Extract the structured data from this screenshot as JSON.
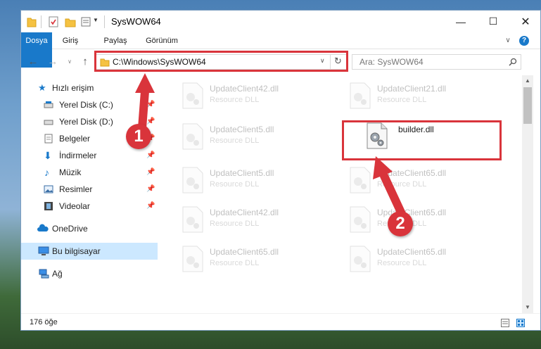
{
  "window": {
    "title": "SysWOW64"
  },
  "ribbon": {
    "tabs": [
      "Dosya",
      "Giriş",
      "Paylaş",
      "Görünüm"
    ]
  },
  "address": {
    "path": "C:\\Windows\\SysWOW64"
  },
  "search": {
    "placeholder": "Ara: SysWOW64"
  },
  "nav": {
    "quick_access": "Hızlı erişim",
    "items": [
      "Yerel Disk (C:)",
      "Yerel Disk (D:)",
      "Belgeler",
      "İndirmeler",
      "Müzik",
      "Resimler",
      "Videolar"
    ],
    "onedrive": "OneDrive",
    "this_pc": "Bu bilgisayar",
    "network": "Ağ"
  },
  "files": [
    {
      "name": "UpdateClient42.dll",
      "desc": "Resource DLL"
    },
    {
      "name": "UpdateClient21.dll",
      "desc": "Resource DLL"
    },
    {
      "name": "UpdateClient5.dll",
      "desc": "Resource DLL"
    },
    {
      "name": "builder.dll",
      "desc": ""
    },
    {
      "name": "UpdateClient5.dll",
      "desc": "Resource DLL"
    },
    {
      "name": "UpdateClient65.dll",
      "desc": "Resource DLL"
    },
    {
      "name": "UpdateClient42.dll",
      "desc": "Resource DLL"
    },
    {
      "name": "UpdateClient65.dll",
      "desc": "Resource DLL"
    },
    {
      "name": "UpdateClient65.dll",
      "desc": "Resource DLL"
    },
    {
      "name": "UpdateClient65.dll",
      "desc": "Resource DLL"
    }
  ],
  "status": {
    "count": "176 öğe"
  },
  "annotations": {
    "step1": "1",
    "step2": "2"
  },
  "colors": {
    "accent": "#1979ca",
    "annotation": "#d9343b",
    "selection": "#cce8ff"
  }
}
